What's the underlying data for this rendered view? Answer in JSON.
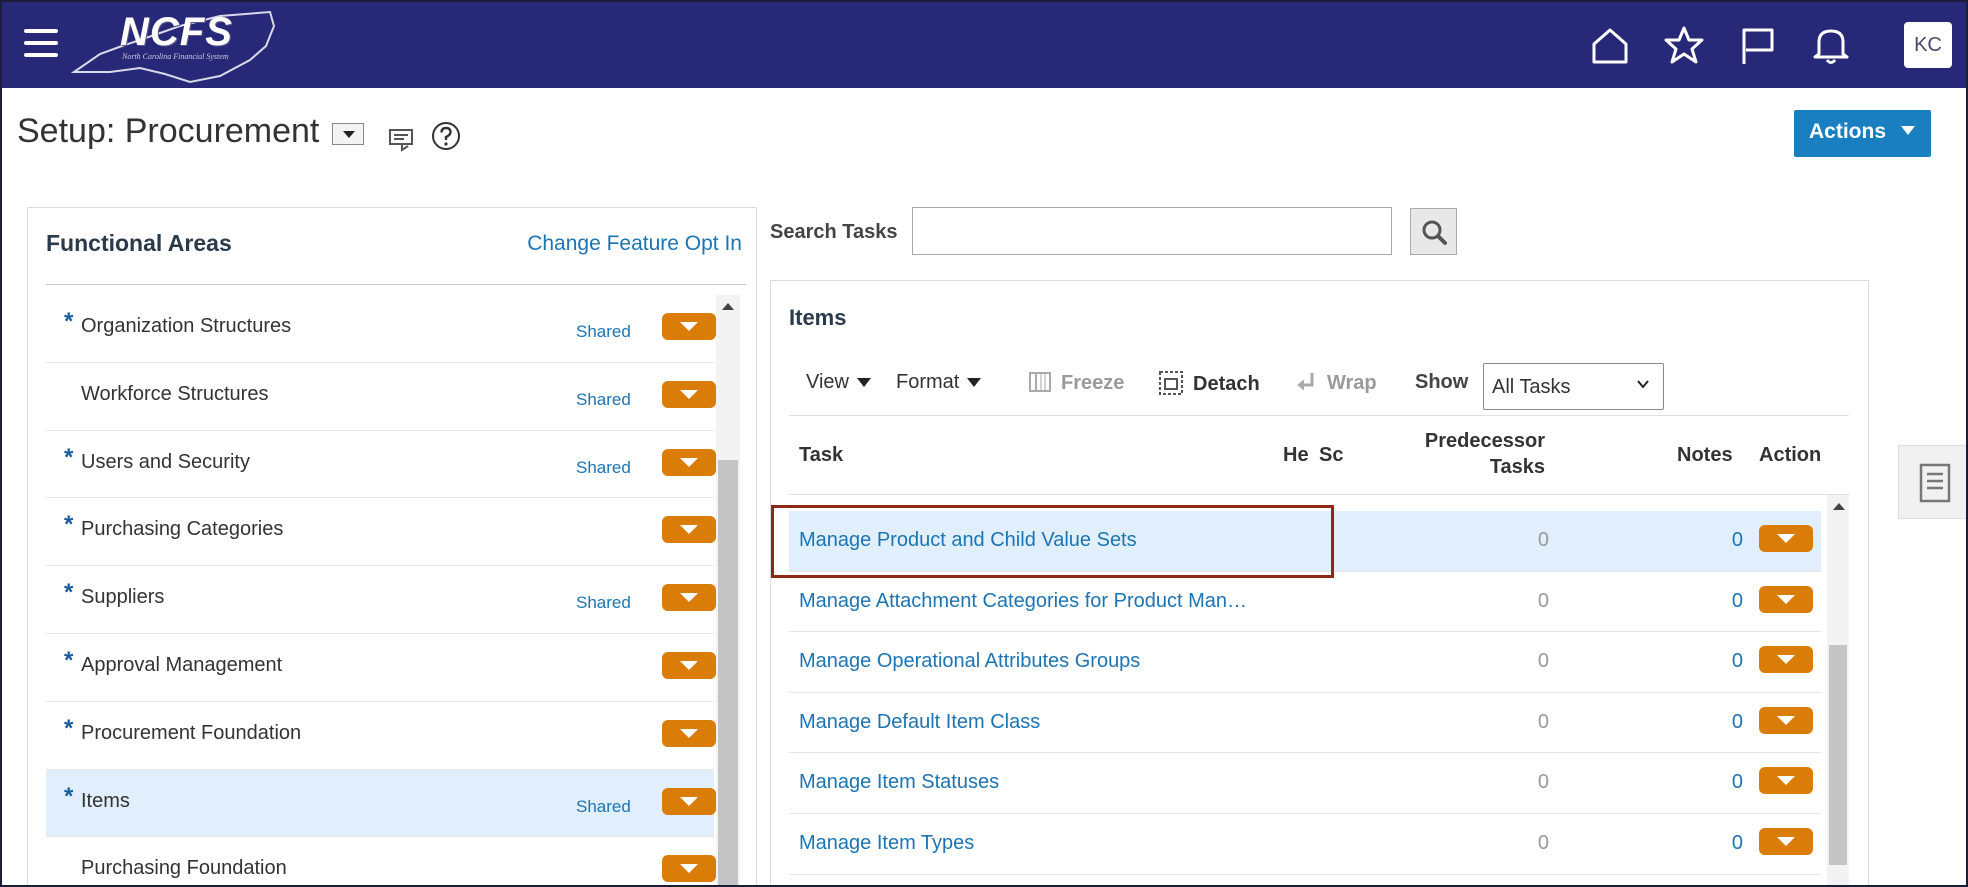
{
  "header": {
    "logo_text": "NCFS",
    "logo_subtext": "North Carolina Financial System",
    "avatar_initials": "KC",
    "icons": [
      "home-icon",
      "favorites-star-icon",
      "flag-icon",
      "notifications-bell-icon"
    ]
  },
  "page": {
    "title": "Setup: Procurement",
    "actions_label": "Actions"
  },
  "functional_areas": {
    "title": "Functional Areas",
    "change_link": "Change Feature Opt In",
    "items": [
      {
        "required": "*",
        "label": "Organization Structures",
        "shared": "Shared"
      },
      {
        "required": "",
        "label": "Workforce Structures",
        "shared": "Shared"
      },
      {
        "required": "*",
        "label": "Users and Security",
        "shared": "Shared"
      },
      {
        "required": "*",
        "label": "Purchasing Categories",
        "shared": ""
      },
      {
        "required": "*",
        "label": "Suppliers",
        "shared": "Shared"
      },
      {
        "required": "*",
        "label": "Approval Management",
        "shared": ""
      },
      {
        "required": "*",
        "label": "Procurement Foundation",
        "shared": ""
      },
      {
        "required": "*",
        "label": "Items",
        "shared": "Shared",
        "selected": true
      },
      {
        "required": "",
        "label": "Purchasing Foundation",
        "shared": ""
      }
    ]
  },
  "search": {
    "label": "Search Tasks",
    "value": ""
  },
  "items_panel": {
    "title": "Items",
    "toolbar": {
      "view": "View",
      "format": "Format",
      "freeze": "Freeze",
      "detach": "Detach",
      "wrap": "Wrap",
      "show": "Show",
      "show_value": "All Tasks"
    },
    "columns": {
      "task": "Task",
      "he": "He",
      "sc": "Sc",
      "predecessor_1": "Predecessor",
      "predecessor_2": "Tasks",
      "notes": "Notes",
      "action": "Action"
    },
    "rows": [
      {
        "task": "Manage Product and Child Value Sets",
        "predecessor": "0",
        "notes": "0",
        "selected": true
      },
      {
        "task": "Manage Attachment Categories for Product Man…",
        "predecessor": "0",
        "notes": "0"
      },
      {
        "task": "Manage Operational Attributes Groups",
        "predecessor": "0",
        "notes": "0"
      },
      {
        "task": "Manage Default Item Class",
        "predecessor": "0",
        "notes": "0"
      },
      {
        "task": "Manage Item Statuses",
        "predecessor": "0",
        "notes": "0"
      },
      {
        "task": "Manage Item Types",
        "predecessor": "0",
        "notes": "0"
      }
    ]
  },
  "colors": {
    "header_bg": "#282878",
    "accent_blue": "#1a7fc1",
    "action_orange": "#d97d08",
    "highlight_border": "#8e2a14",
    "selected_row": "#e0effb"
  }
}
